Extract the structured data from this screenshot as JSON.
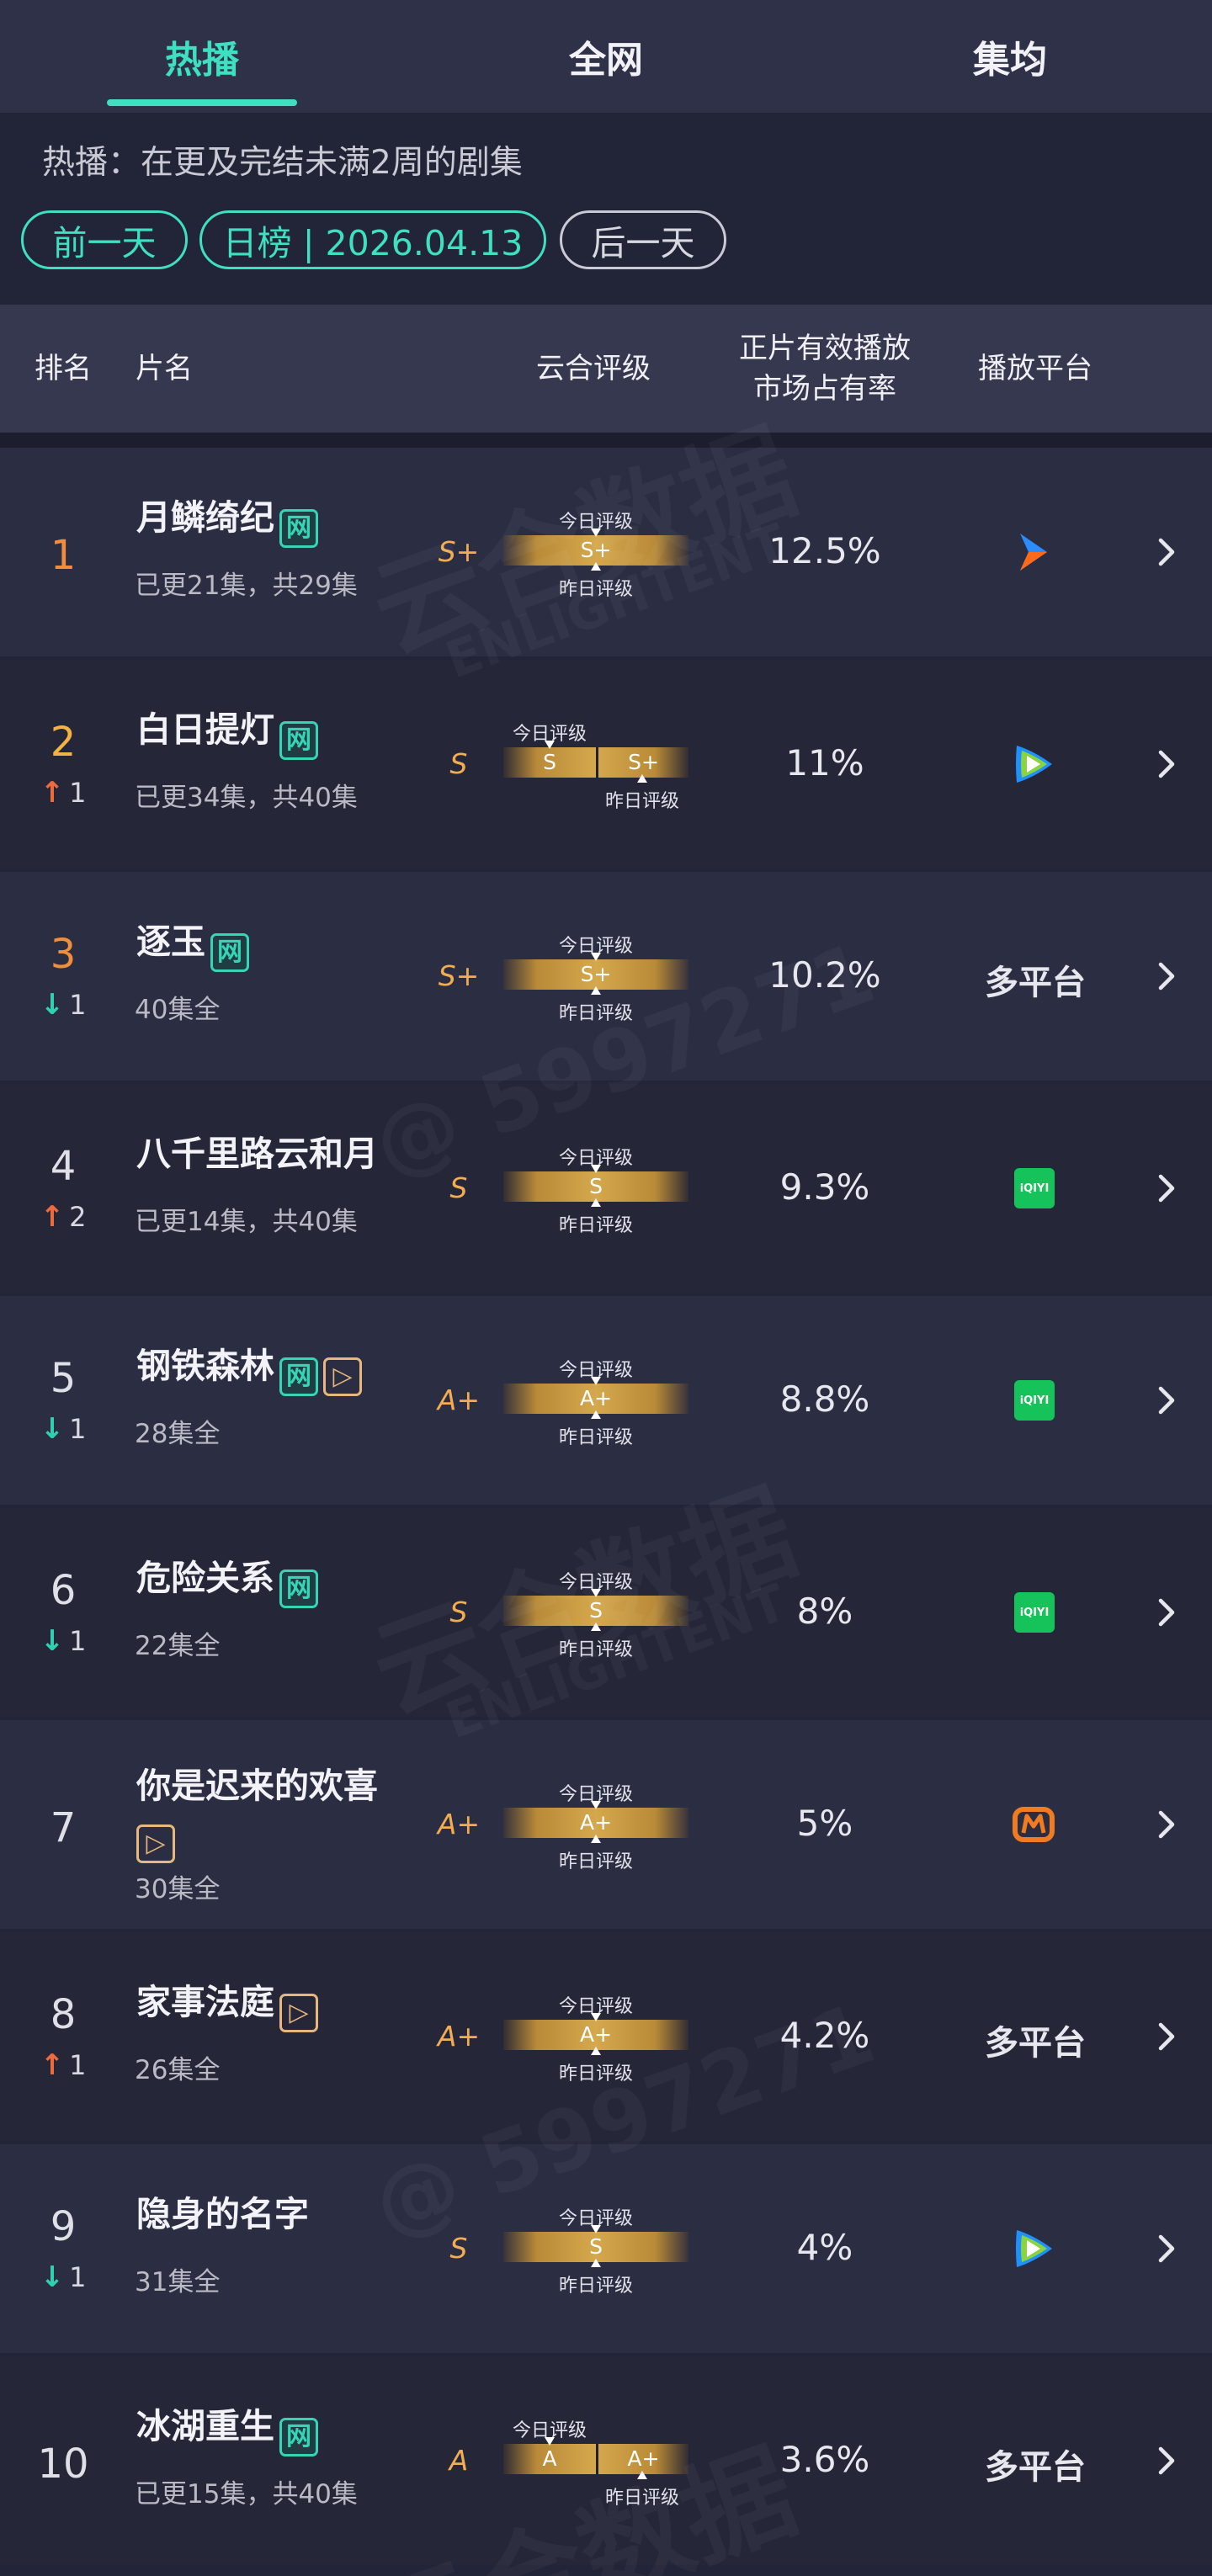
{
  "tabs": [
    "热播",
    "全网",
    "集均"
  ],
  "description": "热播：在更及完结未满2周的剧集",
  "date_nav": {
    "prev": "前一天",
    "current": "日榜 | 2026.04.13",
    "next": "后一天"
  },
  "header": {
    "rank": "排名",
    "title": "片名",
    "rating": "云合评级",
    "share": "正片有效播放市场占有率",
    "share_line1": "正片有效播放",
    "share_line2": "市场占有率",
    "platform": "播放平台"
  },
  "grade_labels": {
    "today": "今日评级",
    "yesterday": "昨日评级"
  },
  "watermarks": {
    "brand": "云合数据",
    "brand_en": "ENLIGHTENT",
    "user": "@ 5997271"
  },
  "badges": {
    "net": "网",
    "play": "▷"
  },
  "rows": [
    {
      "rank": "1",
      "title": "月鳞绮纪",
      "badges": [
        "网"
      ],
      "sub": "已更21集，共29集",
      "change_dir": "",
      "change": "",
      "grade": "S+",
      "today": "S+",
      "yesterday": "",
      "share": "12.5%",
      "platform": "",
      "platform_icon": "youku-icon"
    },
    {
      "rank": "2",
      "title": "白日提灯",
      "badges": [
        "网"
      ],
      "sub": "已更34集，共40集",
      "change_dir": "up",
      "change": "1",
      "grade": "S",
      "today": "S",
      "yesterday": "S+",
      "share": "11%",
      "platform": "",
      "platform_icon": "tencent-video-icon"
    },
    {
      "rank": "3",
      "title": "逐玉",
      "badges": [
        "网"
      ],
      "sub": "40集全",
      "change_dir": "down",
      "change": "1",
      "grade": "S+",
      "today": "S+",
      "yesterday": "",
      "share": "10.2%",
      "platform": "多平台",
      "platform_icon": ""
    },
    {
      "rank": "4",
      "title": "八千里路云和月",
      "badges": [],
      "sub": "已更14集，共40集",
      "change_dir": "up",
      "change": "2",
      "grade": "S",
      "today": "S",
      "yesterday": "",
      "share": "9.3%",
      "platform": "",
      "platform_icon": "iqiyi-icon"
    },
    {
      "rank": "5",
      "title": "钢铁森林",
      "badges": [
        "网",
        "▷"
      ],
      "sub": "28集全",
      "change_dir": "down",
      "change": "1",
      "grade": "A+",
      "today": "A+",
      "yesterday": "",
      "share": "8.8%",
      "platform": "",
      "platform_icon": "iqiyi-icon"
    },
    {
      "rank": "6",
      "title": "危险关系",
      "badges": [
        "网"
      ],
      "sub": "22集全",
      "change_dir": "down",
      "change": "1",
      "grade": "S",
      "today": "S",
      "yesterday": "",
      "share": "8%",
      "platform": "",
      "platform_icon": "iqiyi-icon"
    },
    {
      "rank": "7",
      "title": "你是迟来的欢喜",
      "badges": [
        "▷"
      ],
      "sub": "30集全",
      "change_dir": "",
      "change": "",
      "grade": "A+",
      "today": "A+",
      "yesterday": "",
      "share": "5%",
      "platform": "",
      "platform_icon": "mango-tv-icon"
    },
    {
      "rank": "8",
      "title": "家事法庭",
      "badges": [
        "▷"
      ],
      "sub": "26集全",
      "change_dir": "up",
      "change": "1",
      "grade": "A+",
      "today": "A+",
      "yesterday": "",
      "share": "4.2%",
      "platform": "多平台",
      "platform_icon": ""
    },
    {
      "rank": "9",
      "title": "隐身的名字",
      "badges": [],
      "sub": "31集全",
      "change_dir": "down",
      "change": "1",
      "grade": "S",
      "today": "S",
      "yesterday": "",
      "share": "4%",
      "platform": "",
      "platform_icon": "tencent-video-icon"
    },
    {
      "rank": "10",
      "title": "冰湖重生",
      "badges": [
        "网"
      ],
      "sub": "已更15集，共40集",
      "change_dir": "",
      "change": "",
      "grade": "A",
      "today": "A",
      "yesterday": "A+",
      "share": "3.6%",
      "platform": "多平台",
      "platform_icon": ""
    }
  ],
  "colors": {
    "accent": "#3ee0c1",
    "rank_top": "#ef8f3b",
    "up": "#ee6b3d",
    "down": "#2fd2b0",
    "grade": "#f2ad52",
    "iqiyi": "#16c35a",
    "mango": "#f07b20"
  }
}
